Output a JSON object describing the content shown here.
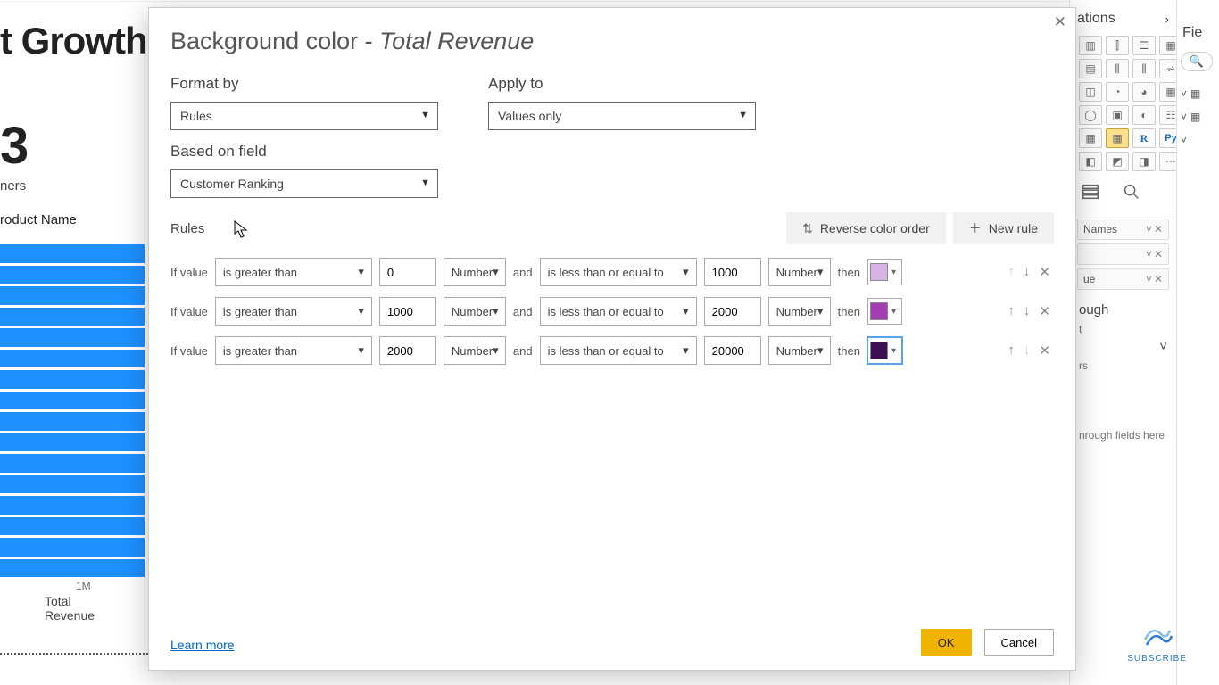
{
  "background": {
    "title_fragment": "t Growth",
    "big_number": "3",
    "caption": "ners",
    "col_header": "roduct Name",
    "axis_tick": "1M",
    "axis_label": "Total Revenue"
  },
  "viz": {
    "pane_title": "ations",
    "chevron": "›",
    "icons": [
      {
        "g": "▥"
      },
      {
        "g": "⫿"
      },
      {
        "g": "☰"
      },
      {
        "g": "▦"
      },
      {
        "g": "▤"
      },
      {
        "g": "⫼"
      },
      {
        "g": "⫼"
      },
      {
        "g": "⩫"
      },
      {
        "g": "◫"
      },
      {
        "g": "◔"
      },
      {
        "g": "◕"
      },
      {
        "g": "▦"
      },
      {
        "g": "◯"
      },
      {
        "g": "▣"
      },
      {
        "g": "◐"
      },
      {
        "g": "☷"
      },
      {
        "g": "▦"
      },
      {
        "g": "▦",
        "sel": true
      },
      {
        "g": "R",
        "cls": "r"
      },
      {
        "g": "Py",
        "cls": "py"
      },
      {
        "g": "◧"
      },
      {
        "g": "◩"
      },
      {
        "g": "◨"
      },
      {
        "g": "⋯"
      }
    ],
    "field_names_label": "Names",
    "field_value_label": "ue",
    "drill_label": "ough",
    "drill_caption": "t",
    "drill_rows_caption": "rs",
    "drill_hint": "nrough fields here"
  },
  "fields": {
    "label": "Fie",
    "search_placeholder": "Search"
  },
  "dialog": {
    "title_prefix": "Background color - ",
    "title_field": "Total Revenue",
    "format_by_label": "Format by",
    "format_by_value": "Rules",
    "apply_to_label": "Apply to",
    "apply_to_value": "Values only",
    "based_on_label": "Based on field",
    "based_on_value": "Customer Ranking",
    "rules_label": "Rules",
    "reverse_btn": "Reverse color order",
    "newrule_btn": "New rule",
    "if_value": "If value",
    "and": "and",
    "then": "then",
    "number_type": "Number",
    "rules": [
      {
        "op1": "is greater than",
        "v1": "0",
        "op2": "is less than or equal to",
        "v2": "1000",
        "color": "#d9b3e6",
        "active": false,
        "up_disabled": true,
        "down_disabled": false
      },
      {
        "op1": "is greater than",
        "v1": "1000",
        "op2": "is less than or equal to",
        "v2": "2000",
        "color": "#a53db5",
        "active": false,
        "up_disabled": false,
        "down_disabled": false
      },
      {
        "op1": "is greater than",
        "v1": "2000",
        "op2": "is less than or equal to",
        "v2": "20000",
        "color": "#3c1053",
        "active": true,
        "up_disabled": false,
        "down_disabled": true
      }
    ],
    "learn_more": "Learn more",
    "ok": "OK",
    "cancel": "Cancel"
  },
  "subscribe": "SUBSCRIBE"
}
